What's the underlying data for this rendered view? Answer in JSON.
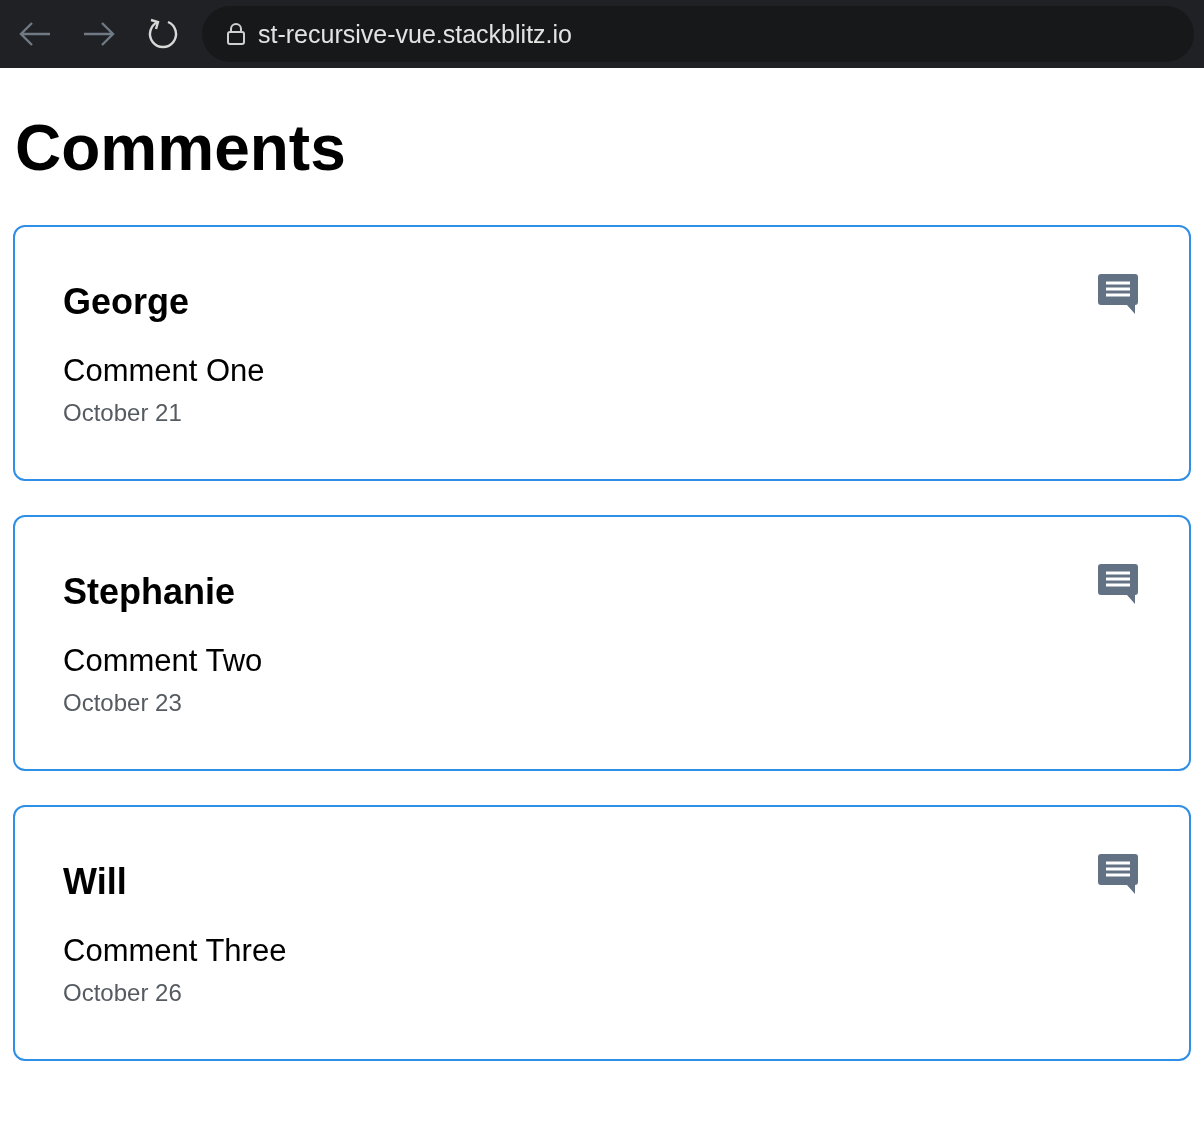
{
  "browser": {
    "url": "st-recursive-vue.stackblitz.io"
  },
  "heading": "Comments",
  "comments": [
    {
      "author": "George",
      "text": "Comment One",
      "date": "October 21"
    },
    {
      "author": "Stephanie",
      "text": "Comment Two",
      "date": "October 23"
    },
    {
      "author": "Will",
      "text": "Comment Three",
      "date": "October 26"
    }
  ]
}
